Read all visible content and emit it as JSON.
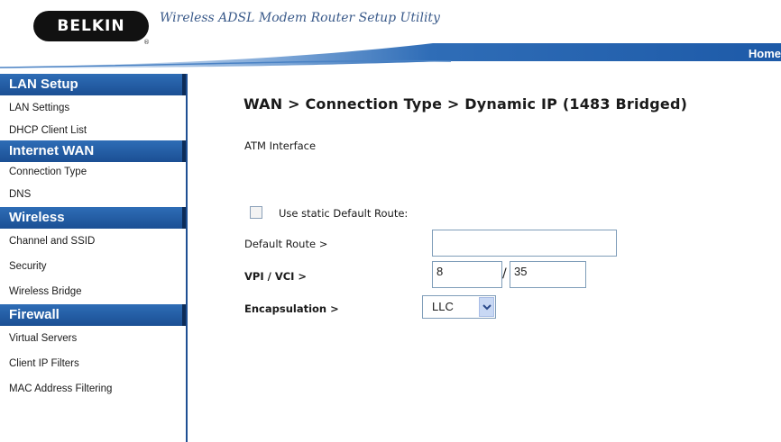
{
  "header": {
    "logo_text": "BELKIN",
    "logo_mark": "®",
    "app_title": "Wireless ADSL Modem Router Setup Utility",
    "home_link": "Home"
  },
  "sidebar": {
    "sections": [
      {
        "title": "LAN Setup",
        "items": [
          "LAN Settings",
          "DHCP Client List"
        ]
      },
      {
        "title": "Internet WAN",
        "items": [
          "Connection Type",
          "DNS"
        ]
      },
      {
        "title": "Wireless",
        "items": [
          "Channel and SSID",
          "Security",
          "Wireless Bridge"
        ]
      },
      {
        "title": "Firewall",
        "items": [
          "Virtual Servers",
          "Client IP Filters",
          "MAC Address Filtering"
        ]
      }
    ]
  },
  "main": {
    "title": "WAN > Connection Type > Dynamic IP (1483 Bridged)",
    "atm_label": "ATM Interface",
    "static_route_label": "Use static Default Route:",
    "static_route_checked": false,
    "default_route_label": "Default Route >",
    "default_route_value": "",
    "vpi_vci_label": "VPI / VCI >",
    "vpi_value": "8",
    "vci_value": "35",
    "encapsulation_label": "Encapsulation >",
    "encapsulation_value": "LLC"
  },
  "colors": {
    "brand_blue": "#1f4f93",
    "header_blue": "#2e6db6",
    "text": "#1a1a1a"
  }
}
